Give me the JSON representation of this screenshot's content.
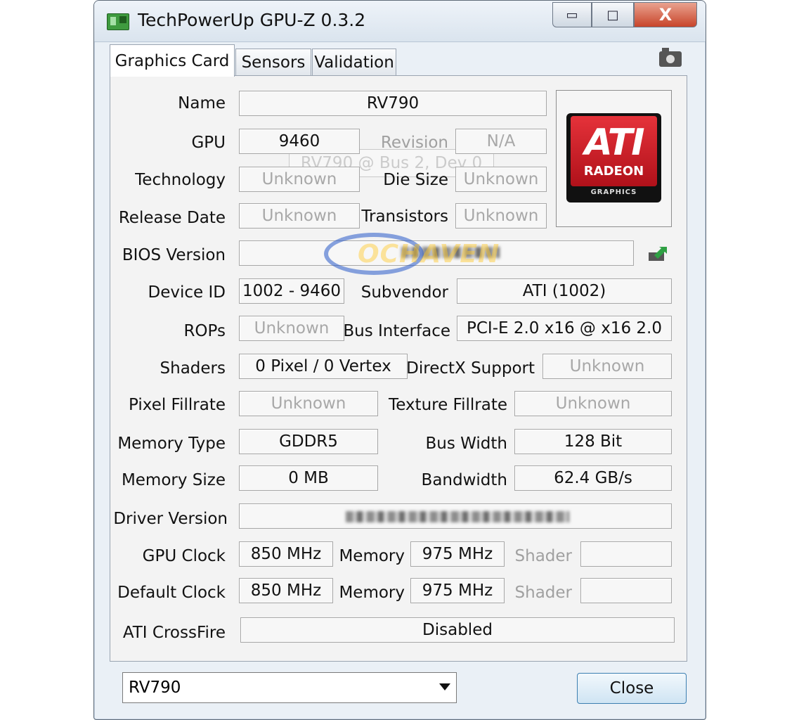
{
  "window": {
    "title": "TechPowerUp GPU-Z 0.3.2"
  },
  "controls": {
    "minimize": "▭",
    "maximize": "□",
    "close": "X"
  },
  "tabs": [
    "Graphics Card",
    "Sensors",
    "Validation"
  ],
  "logo": {
    "ati": "ATI",
    "radeon": "RADEON",
    "graphics": "GRAPHICS"
  },
  "ghost": "RV790 @ Bus 2, Dev 0",
  "watermark": "OCHAVEN",
  "labels": {
    "name": "Name",
    "gpu": "GPU",
    "revision": "Revision",
    "technology": "Technology",
    "die_size": "Die Size",
    "release_date": "Release Date",
    "transistors": "Transistors",
    "bios_version": "BIOS Version",
    "device_id": "Device ID",
    "subvendor": "Subvendor",
    "rops": "ROPs",
    "bus_interface": "Bus Interface",
    "shaders": "Shaders",
    "directx_support": "DirectX Support",
    "pixel_fillrate": "Pixel Fillrate",
    "texture_fillrate": "Texture Fillrate",
    "memory_type": "Memory Type",
    "bus_width": "Bus Width",
    "memory_size": "Memory Size",
    "bandwidth": "Bandwidth",
    "driver_version": "Driver Version",
    "gpu_clock": "GPU Clock",
    "memory": "Memory",
    "shader": "Shader",
    "default_clock": "Default Clock",
    "ati_crossfire": "ATI CrossFire"
  },
  "values": {
    "name": "RV790",
    "gpu": "9460",
    "revision": "N/A",
    "technology": "Unknown",
    "die_size": "Unknown",
    "release_date": "Unknown",
    "transistors": "Unknown",
    "device_id": "1002 - 9460",
    "subvendor": "ATI (1002)",
    "rops": "Unknown",
    "bus_interface": "PCI-E 2.0 x16 @ x16 2.0",
    "shaders": "0 Pixel / 0 Vertex",
    "directx_support": "Unknown",
    "pixel_fillrate": "Unknown",
    "texture_fillrate": "Unknown",
    "memory_type": "GDDR5",
    "bus_width": "128 Bit",
    "memory_size": "0 MB",
    "bandwidth": "62.4 GB/s",
    "gpu_clock": "850 MHz",
    "memory_clock": "975 MHz",
    "shader_clock": "",
    "default_clock": "850 MHz",
    "default_memory": "975 MHz",
    "default_shader": "",
    "ati_crossfire": "Disabled"
  },
  "footer": {
    "selected_gpu": "RV790",
    "close_label": "Close"
  },
  "colors": {
    "ati_red": "#d0202a",
    "close_button": "#c8442a"
  }
}
